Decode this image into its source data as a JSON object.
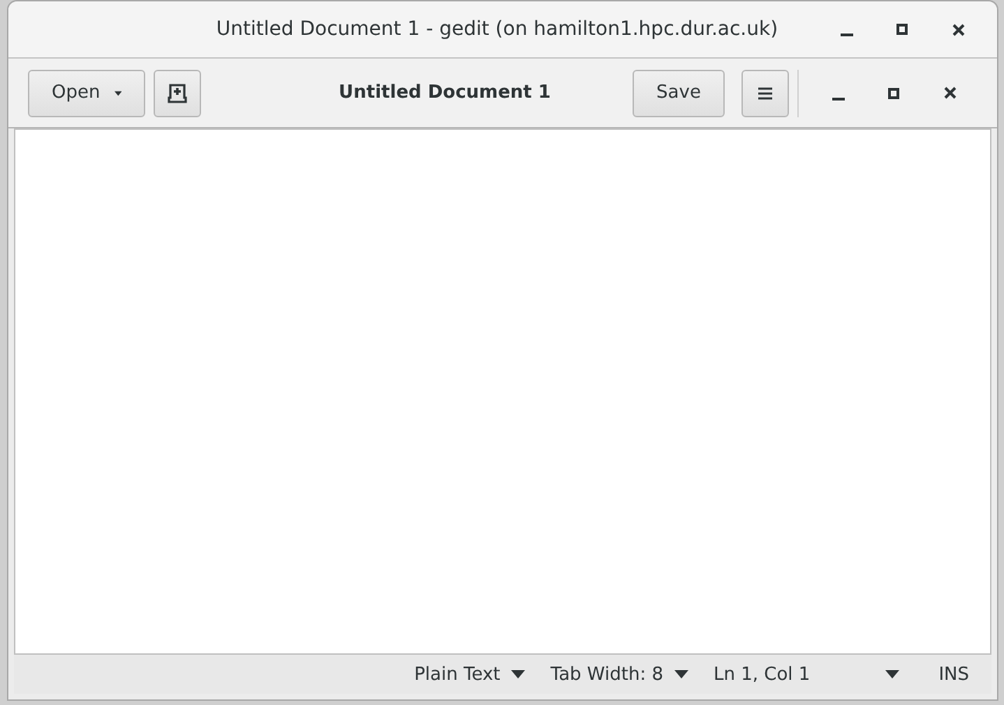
{
  "window": {
    "title": "Untitled Document 1 - gedit (on hamilton1.hpc.dur.ac.uk)"
  },
  "header_bar": {
    "open_button": {
      "label": "Open"
    },
    "title": "Untitled Document 1",
    "save_button": {
      "label": "Save"
    }
  },
  "status_bar": [
    {
      "kind": "dropdown",
      "label": "Plain Text"
    },
    {
      "kind": "dropdown",
      "label": "Tab Width: 8"
    },
    {
      "kind": "text",
      "label": "Ln 1, Col 1"
    },
    {
      "kind": "caret"
    },
    {
      "kind": "text",
      "label": "INS"
    }
  ]
}
